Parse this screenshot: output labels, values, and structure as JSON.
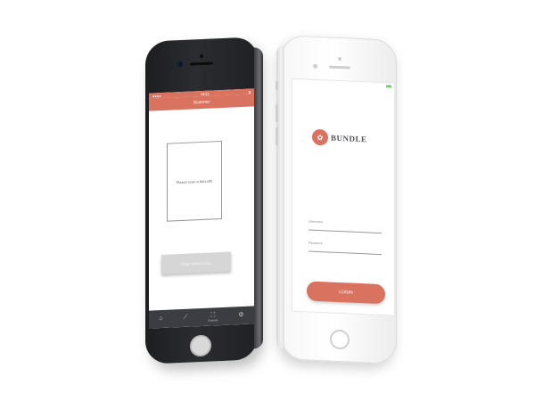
{
  "scanner_app": {
    "status_time": "16:51",
    "header_title": "Scanner",
    "qr_prompt": "Please scan a barcode",
    "enter_button_label": "Enter serial code",
    "tabs": [
      {
        "icon": "home-icon",
        "glyph": "⌂",
        "label": ""
      },
      {
        "icon": "chart-icon",
        "glyph": "⟋",
        "label": ""
      },
      {
        "icon": "scan-icon",
        "glyph": "⛶",
        "label": "Scanner"
      },
      {
        "icon": "settings-icon",
        "glyph": "⚙",
        "label": ""
      }
    ]
  },
  "login_app": {
    "brand_name": "BUNDLE",
    "logo_glyph": "✿",
    "username_label": "Username",
    "password_label": "Password",
    "login_button_label": "LOGIN"
  },
  "colors": {
    "accent": "#d9735f",
    "tabbar": "#3b3d42",
    "disabled_button": "#d6d6d6"
  }
}
